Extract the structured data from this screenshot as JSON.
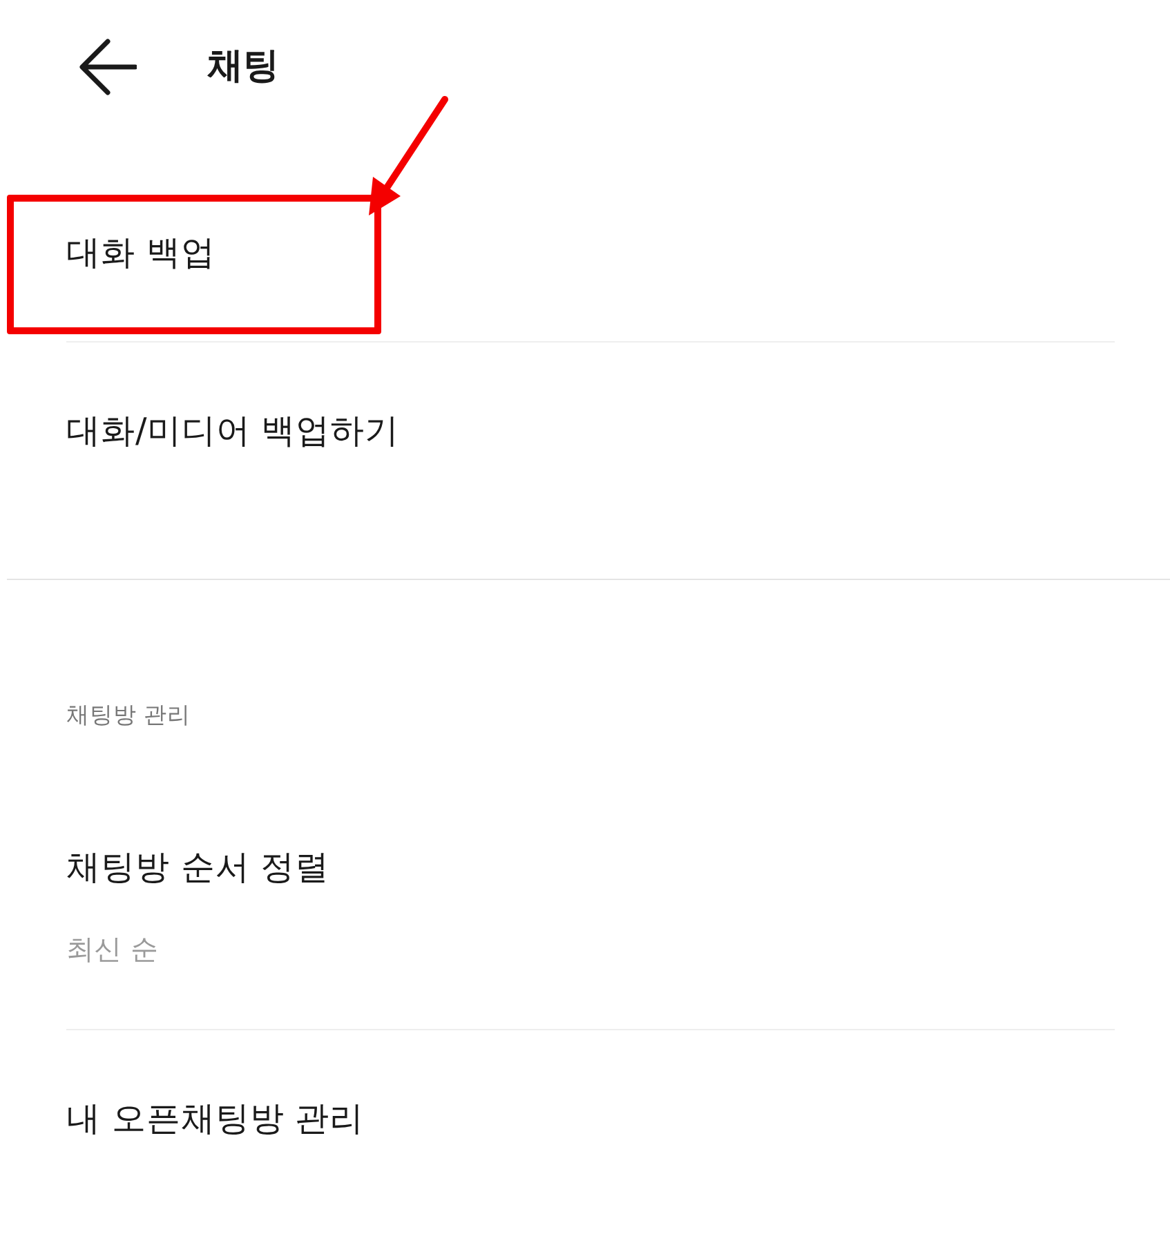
{
  "header": {
    "title": "채팅"
  },
  "sections": [
    {
      "items": [
        {
          "label": "대화 백업",
          "highlighted": true
        },
        {
          "label": "대화/미디어 백업하기",
          "highlighted": false
        }
      ]
    },
    {
      "header": "채팅방 관리",
      "items": [
        {
          "label": "채팅방 순서 정렬",
          "value": "최신 순",
          "highlighted": false
        },
        {
          "label": "내 오픈채팅방 관리",
          "highlighted": false
        }
      ]
    }
  ]
}
